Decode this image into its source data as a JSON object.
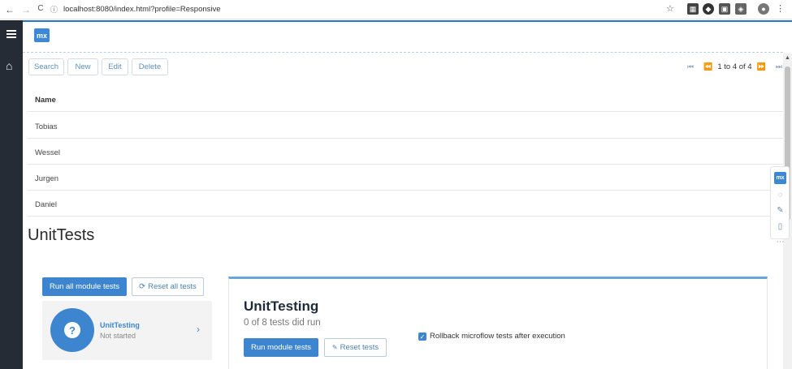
{
  "browser": {
    "url": "localhost:8080/index.html?profile=Responsive",
    "back_icon": "←",
    "forward_icon": "→",
    "reload_icon": "C"
  },
  "toolbar": {
    "search_label": "Search",
    "new_label": "New",
    "edit_label": "Edit",
    "delete_label": "Delete",
    "paging_text": "1 to 4 of 4"
  },
  "grid": {
    "header": "Name",
    "rows": [
      "Tobias",
      "Wessel",
      "Jurgen",
      "Daniel"
    ]
  },
  "unittests": {
    "title": "UnitTests",
    "run_all_label": "Run all module tests",
    "reset_all_label": "Reset all tests",
    "module_name": "UnitTesting",
    "module_status": "Not started",
    "panel_title": "UnitTesting",
    "panel_subtitle": "0 of 8 tests did run",
    "run_module_label": "Run module tests",
    "reset_tests_label": "Reset tests",
    "rollback_label": "Rollback microflow tests after execution"
  },
  "brand": {
    "logo_text": "mx",
    "accent": "#3d86cf",
    "sidebar_bg": "#252c36"
  }
}
